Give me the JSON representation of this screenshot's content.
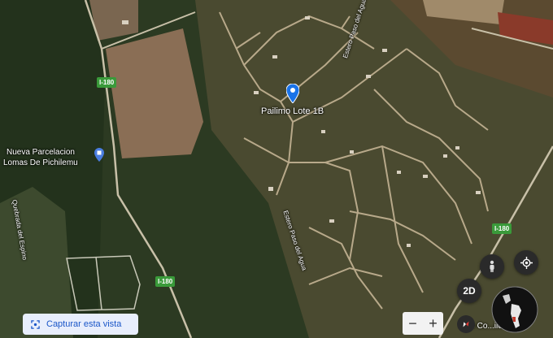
{
  "place_labels": {
    "pin_place": "Pailimo Lote 1B",
    "parcel_line1": "Nueva Parcelacion",
    "parcel_line2": "Lomas De Pichilemu",
    "estero_upper": "Estero Paso del Agua",
    "estero_lower": "Estero Paso del Agua",
    "quebrada": "Quebrada del Espino",
    "bottom_right_partial": "ecto Co...ilemu"
  },
  "road_labels": {
    "i180_a": "I-180",
    "i180_b": "I-180",
    "i180_c": "I-180"
  },
  "controls": {
    "capture_label": "Capturar esta vista",
    "mode_2d": "2D",
    "zoom_out": "−",
    "zoom_in": "+"
  },
  "icons": {
    "pin": "map-pin-icon",
    "parcel": "location-pin-icon",
    "pegman": "street-view-person-icon",
    "locate": "my-location-icon",
    "camera": "camera-capture-icon",
    "compass": "compass-icon",
    "globe": "globe-icon"
  },
  "colors": {
    "pin": "#1a73e8",
    "road_tag": "#3a9a3a",
    "capture_text": "#1a56c8"
  }
}
